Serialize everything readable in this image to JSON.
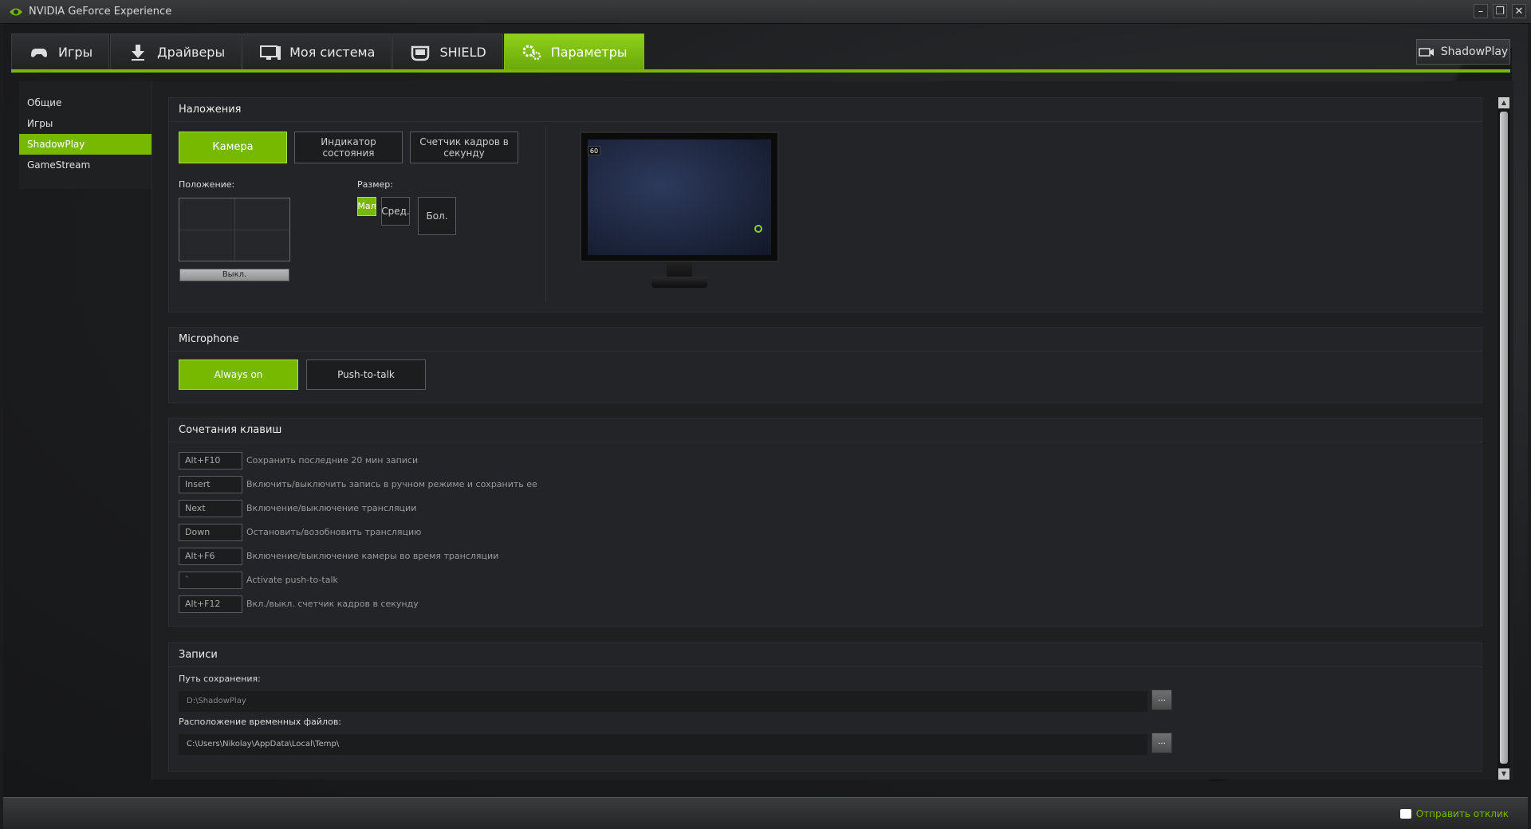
{
  "window": {
    "title": "NVIDIA GeForce Experience"
  },
  "tabs": [
    {
      "label": "Игры",
      "icon": "gamepad-icon"
    },
    {
      "label": "Драйверы",
      "icon": "download-icon"
    },
    {
      "label": "Моя система",
      "icon": "monitor-icon"
    },
    {
      "label": "SHIELD",
      "icon": "shield-device-icon"
    },
    {
      "label": "Параметры",
      "icon": "gears-icon"
    }
  ],
  "active_tab": "Параметры",
  "shadowplay_button": {
    "label": "ShadowPlay",
    "icon": "camera-icon"
  },
  "sidebar": {
    "items": [
      {
        "label": "Общие"
      },
      {
        "label": "Игры"
      },
      {
        "label": "ShadowPlay"
      },
      {
        "label": "GameStream"
      }
    ],
    "active": "ShadowPlay"
  },
  "overlays": {
    "title": "Наложения",
    "buttons": [
      "Камера",
      "Индикатор состояния",
      "Счетчик кадров в секунду"
    ],
    "active": "Камера",
    "position_label": "Положение:",
    "off_label": "Выкл.",
    "size_label": "Размер:",
    "sizes": [
      "Мал",
      "Сред.",
      "Бол."
    ],
    "active_size": "Мал",
    "preview_fps": "60"
  },
  "microphone": {
    "title": "Microphone",
    "buttons": [
      "Always on",
      "Push-to-talk"
    ],
    "active": "Always on"
  },
  "hotkeys": {
    "title": "Сочетания клавиш",
    "rows": [
      {
        "key": "Alt+F10",
        "desc": "Сохранить последние 20 мин записи"
      },
      {
        "key": "Insert",
        "desc": "Включить/выключить запись в ручном режиме и сохранить ее"
      },
      {
        "key": "Next",
        "desc": "Включение/выключение трансляции"
      },
      {
        "key": "Down",
        "desc": "Остановить/возобновить трансляцию"
      },
      {
        "key": "Alt+F6",
        "desc": "Включение/выключение камеры во время трансляции"
      },
      {
        "key": "`",
        "desc": "Activate push-to-talk"
      },
      {
        "key": "Alt+F12",
        "desc": "Вкл./выкл. счетчик кадров в секунду"
      }
    ]
  },
  "recordings": {
    "title": "Записи",
    "save_path_label": "Путь сохранения:",
    "save_path": "D:\\ShadowPlay",
    "temp_label": "Расположение временных файлов:",
    "temp_path": "C:\\Users\\Nikolay\\AppData\\Local\\Temp\\",
    "browse_label": "..."
  },
  "status": {
    "feedback_label": "Отправить отклик"
  },
  "colors": {
    "accent": "#76b900",
    "background": "#1e1f21"
  }
}
